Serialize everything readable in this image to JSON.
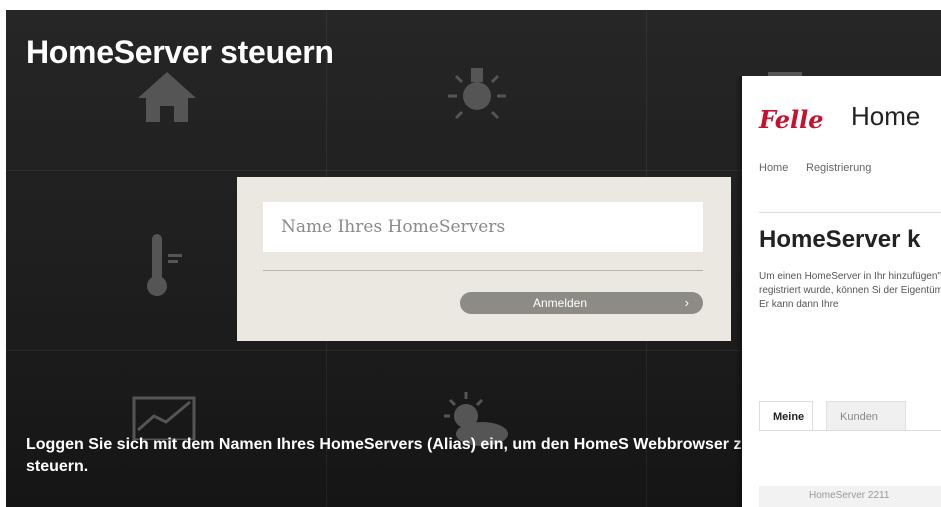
{
  "hero": {
    "title": "HomeServer steuern",
    "description": "Loggen Sie sich mit dem Namen Ihres HomeServers (Alias) ein, um den HomeS Webbrowser zu steuern."
  },
  "login": {
    "placeholder": "Name Ihres HomeServers",
    "button_label": "Anmelden",
    "button_chevron": "›"
  },
  "background_icons": [
    "home-icon",
    "lightbulb-icon",
    "thermometer-icon",
    "chart-icon",
    "sun-cloud-icon"
  ],
  "overlay": {
    "logo_text": "Felle",
    "brand": "Home",
    "nav": [
      "Home",
      "Registrierung"
    ],
    "heading": "HomeServer k",
    "description": "Um einen HomeServer in Ihr hinzufügen\" und geben die T registriert wurde, können Si der Eigentümer damit einver gesendet. Er kann dann Ihre",
    "tabs": [
      "Meine",
      "Kunden"
    ],
    "row_text": "HomeServer 2211"
  },
  "colors": {
    "brand_red": "#c8102e",
    "panel_dark": "#222222",
    "card_bg": "#ebe8e2",
    "button_gray": "#8d8b86"
  }
}
